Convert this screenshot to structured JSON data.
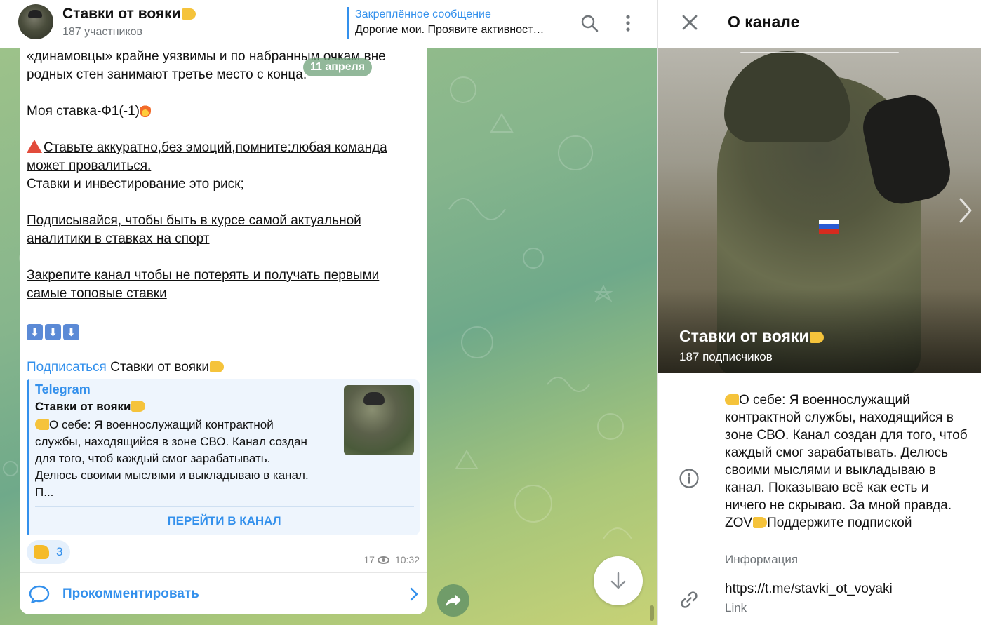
{
  "header": {
    "title": "Ставки от вояки",
    "subtitle": "187 участников",
    "pinned_title": "Закреплённое сообщение",
    "pinned_text": "Дорогие мои. Проявите активност…"
  },
  "message": {
    "date": "11 апреля",
    "line1": "«динамовцы» крайне уязвимы и по набранным очкам вне",
    "line2": "родных стен занимают третье место с конца.",
    "bet": "Моя ставка-Ф1(-1)",
    "warn1": "Ставьте аккуратно,без эмоций,помните:любая команда ",
    "warn2": "может провалиться.",
    "warn3": "Ставки и инвестирование это риск;",
    "sub1": "Подписывайся, чтобы быть в курсе самой актуальной ",
    "sub2": "аналитики в ставках на спорт",
    "pin1": "Закрепите канал чтобы не потерять и получать первыми ",
    "pin2": "самые топовые ставки ",
    "subscribe_link": "Подписаться",
    "subscribe_channel": "Ставки от вояки",
    "views": "17",
    "time": "10:32",
    "reaction_count": "3"
  },
  "preview": {
    "site": "Telegram",
    "title": "Ставки от вояки",
    "description": "О себе: Я военнослужащий контрактной службы, находящийся в зоне СВО. Канал создан для того, чтоб каждый смог зарабатывать. Делюсь своими мыслями и выкладываю в канал. П...",
    "button": "ПЕРЕЙТИ В КАНАЛ"
  },
  "comment": {
    "label": "Прокомментировать"
  },
  "panel": {
    "title": "О канале",
    "name": "Ставки от вояки",
    "subscribers": "187 подписчиков",
    "about": "О себе: Я военнослужащий контрактной службы, находящийся в зоне СВО. Канал создан для того, чтоб каждый смог зарабатывать. Делюсь своими мыслями и выкладываю в канал. Показываю всё как есть и ничего не скрываю. За мной правда. ZOV",
    "about_tail": "Поддержите подпиской",
    "about_label": "Информация",
    "link": "https://t.me/stavki_ot_voyaki",
    "link_label": "Link"
  },
  "colors": {
    "accent": "#3390ec",
    "chat_bg": "#86b58c"
  },
  "icons": [
    "search-icon",
    "more-icon",
    "close-icon",
    "info-icon",
    "link-icon",
    "comment-icon",
    "share-icon",
    "arrow-down-icon",
    "eye-icon",
    "chevron-right-icon"
  ]
}
